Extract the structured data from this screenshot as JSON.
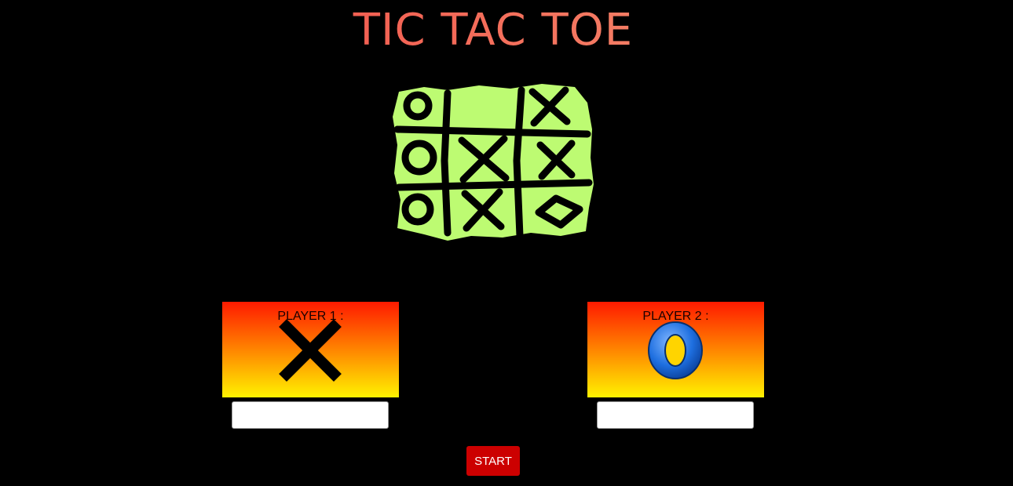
{
  "header": {
    "title": "TIC TAC TOE"
  },
  "logo": {
    "icon": "tic-tac-toe-board-icon",
    "color": "#bdfb72"
  },
  "players": [
    {
      "label": "PLAYER 1 :",
      "symbol_icon": "x-mark-icon",
      "name_value": "",
      "name_placeholder": ""
    },
    {
      "label": "PLAYER 2 :",
      "symbol_icon": "o-mark-icon",
      "name_value": "",
      "name_placeholder": ""
    }
  ],
  "actions": {
    "start_label": "START"
  },
  "colors": {
    "background": "#000000",
    "title_gradient": [
      "#f03c3c",
      "#f7a07a"
    ],
    "card_gradient": [
      "#ff1a00",
      "#fff200"
    ],
    "start_button": "#cc0000",
    "o_mark": "#1e6fe0"
  }
}
